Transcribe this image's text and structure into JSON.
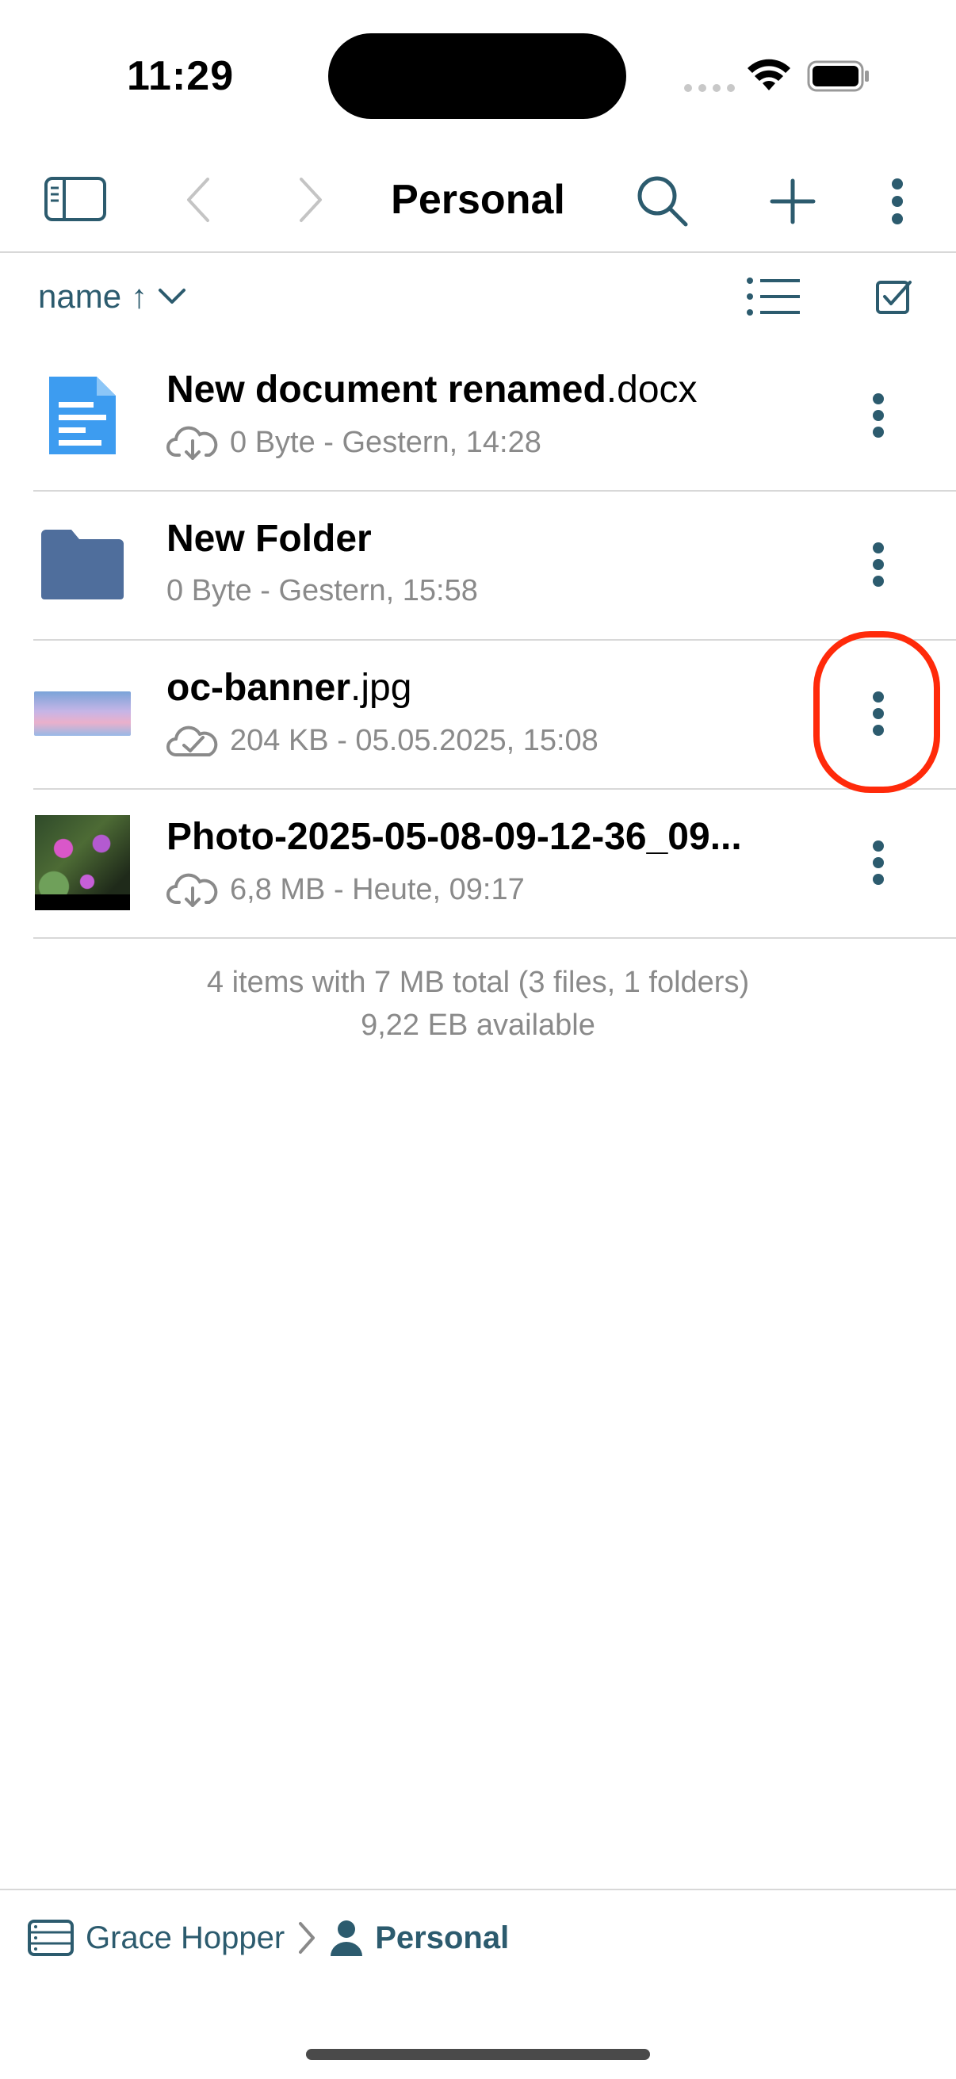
{
  "status_bar": {
    "time": "11:29"
  },
  "nav": {
    "title": "Personal"
  },
  "sort": {
    "label": "name",
    "direction_symbol": "↑"
  },
  "files": [
    {
      "base": "New document renamed",
      "ext": ".docx",
      "meta": "0 Byte - Gestern, 14:28",
      "icon": "document-icon",
      "status_icon": "cloud-download-icon"
    },
    {
      "base": "New Folder",
      "ext": "",
      "meta": "0 Byte - Gestern, 15:58",
      "icon": "folder-icon",
      "status_icon": ""
    },
    {
      "base": "oc-banner",
      "ext": ".jpg",
      "meta": "204 KB - 05.05.2025, 15:08",
      "icon": "image-thumbnail",
      "status_icon": "cloud-check-icon"
    },
    {
      "base": "Photo-2025-05-08-09-12-36_09...",
      "ext": "",
      "meta": "6,8 MB - Heute, 09:17",
      "icon": "photo-thumbnail",
      "status_icon": "cloud-download-icon"
    }
  ],
  "summary": {
    "line1": "4 items with 7 MB total (3 files, 1 folders)",
    "line2": "9,22 EB available"
  },
  "breadcrumb": {
    "account": "Grace Hopper",
    "current": "Personal"
  },
  "colors": {
    "accent": "#2c5b6e",
    "highlight": "#ff2a0a",
    "document_blue": "#3d9cf0",
    "folder_blue": "#4f6e9c"
  }
}
